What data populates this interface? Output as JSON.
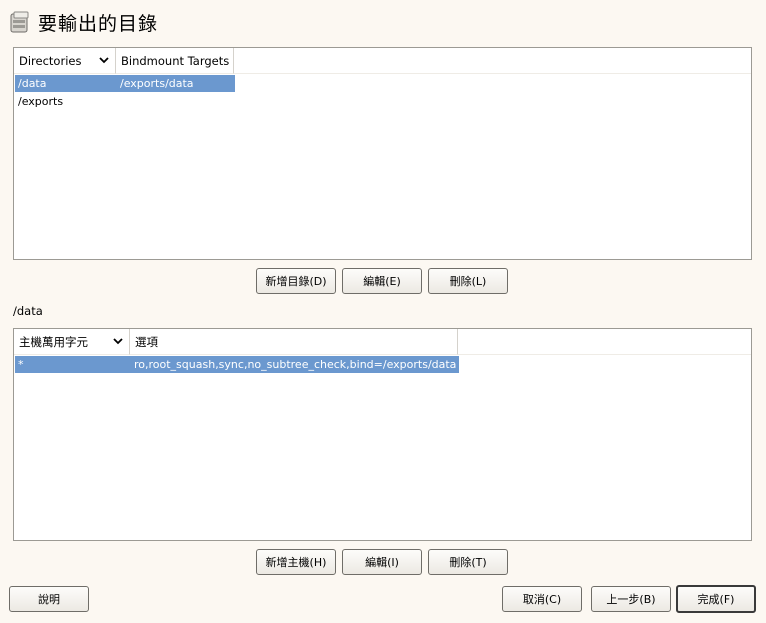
{
  "title": "要輸出的目錄",
  "dirs_table": {
    "columns": [
      "Directories",
      "Bindmount Targets"
    ],
    "rows": [
      {
        "dir": "/data",
        "target": "/exports/data",
        "selected": true
      },
      {
        "dir": "/exports",
        "target": "",
        "selected": false
      }
    ]
  },
  "dir_buttons": {
    "add": "新增目錄(D)",
    "edit": "編輯(E)",
    "delete": "刪除(L)"
  },
  "selected_dir_label": "/data",
  "hosts_table": {
    "columns": [
      "主機萬用字元",
      "選項"
    ],
    "rows": [
      {
        "host": "*",
        "options": "ro,root_squash,sync,no_subtree_check,bind=/exports/data",
        "selected": true
      }
    ]
  },
  "host_buttons": {
    "add": "新增主機(H)",
    "edit": "編輯(I)",
    "delete": "刪除(T)"
  },
  "footer": {
    "help": "說明",
    "cancel": "取消(C)",
    "back": "上一步(B)",
    "finish": "完成(F)"
  },
  "colors": {
    "selection": "#6b98cf",
    "background": "#fcf8f2"
  }
}
